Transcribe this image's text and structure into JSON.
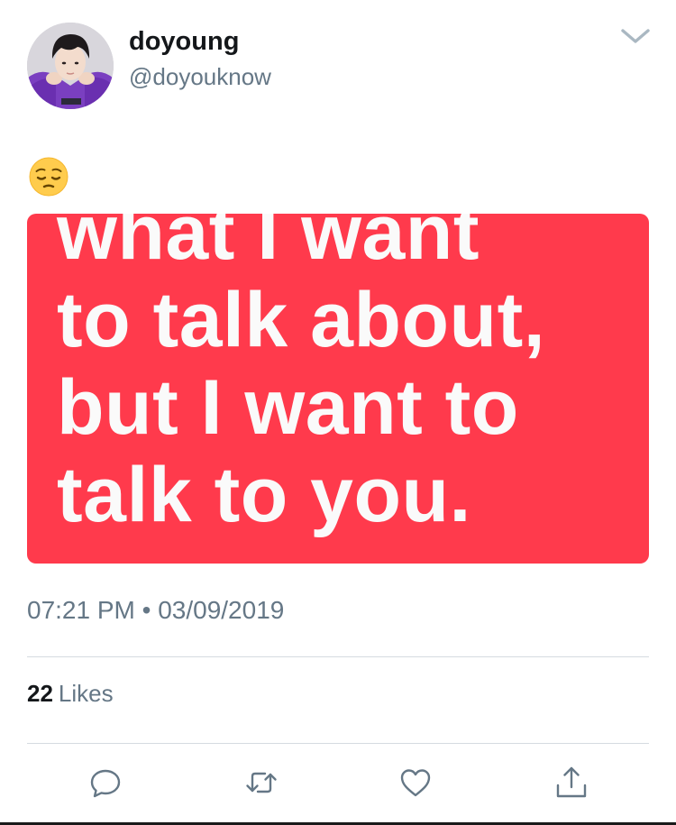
{
  "tweet": {
    "display_name": "doyoung",
    "handle": "@doyouknow",
    "emoji": "😔",
    "media": {
      "lines": [
        "what I want",
        "to talk about,",
        "but I want to",
        "talk to you."
      ],
      "background_color": "#ff3a4c",
      "text_color": "#fafafa"
    },
    "timestamp": "07:21 PM • 03/09/2019",
    "likes_count": "22",
    "likes_label": "Likes"
  },
  "icons": {
    "caret": "chevron-down-icon",
    "reply": "reply-icon",
    "retweet": "retweet-icon",
    "like": "heart-icon",
    "share": "share-icon"
  },
  "colors": {
    "secondary_text": "#657786",
    "primary_text": "#14171a",
    "divider": "#d5dbe0",
    "icon": "#657786"
  }
}
